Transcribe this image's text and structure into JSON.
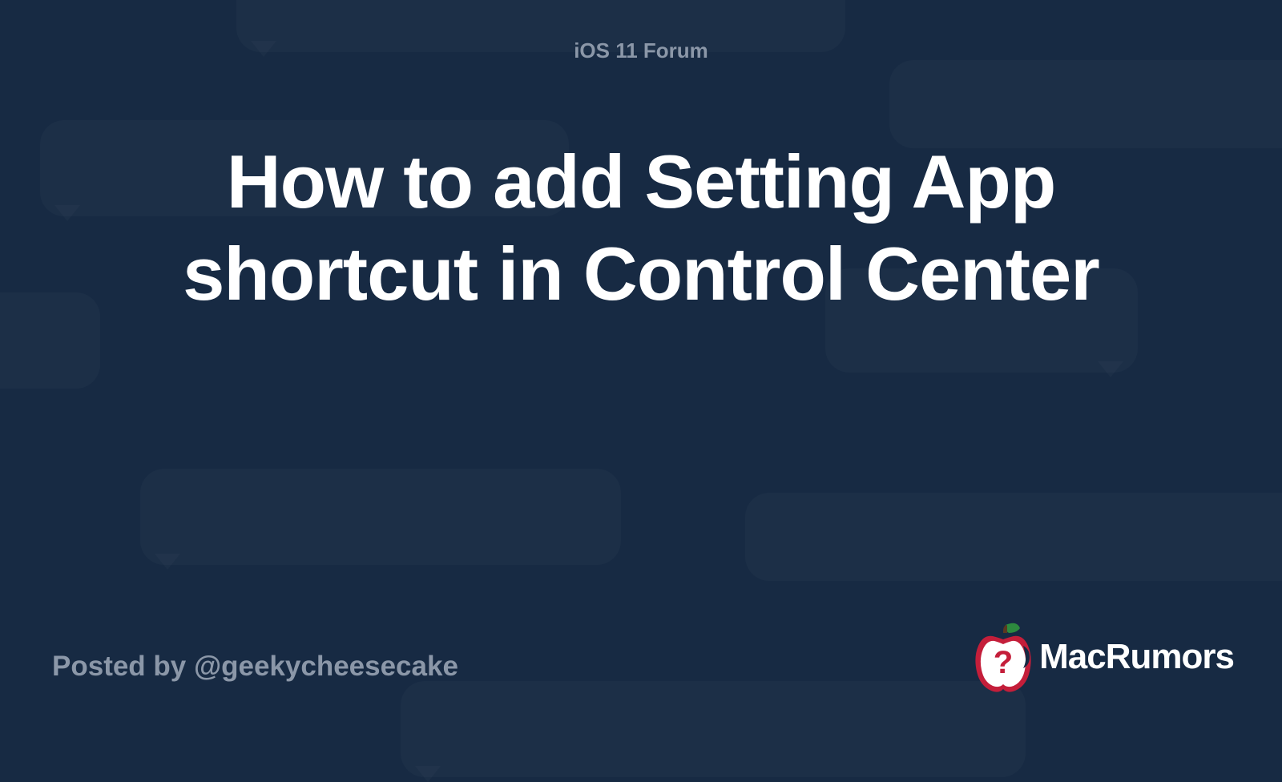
{
  "forum": "iOS 11 Forum",
  "title": "How to add Setting App shortcut in Control Center",
  "posted_by": "Posted by @geekycheesecake",
  "brand": "MacRumors"
}
